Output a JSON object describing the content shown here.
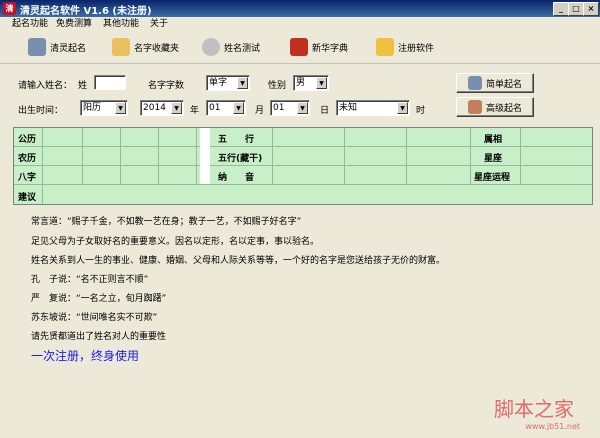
{
  "window": {
    "title": "清灵起名软件 V1.6 (未注册)",
    "app_icon": "清",
    "min": "_",
    "max": "□",
    "close": "×"
  },
  "menu": [
    "起名功能",
    "免费测算",
    "其他功能",
    "关于"
  ],
  "toolbar": [
    {
      "label": "清灵起名",
      "icon": "magnifier-icon",
      "color": "#7a8fb0"
    },
    {
      "label": "名字收藏夹",
      "icon": "folder-icon",
      "color": "#e8c060"
    },
    {
      "label": "姓名测试",
      "icon": "cd-icon",
      "color": "#c0c0c0"
    },
    {
      "label": "新华字典",
      "icon": "book-icon",
      "color": "#c03020"
    },
    {
      "label": "注册软件",
      "icon": "key-icon",
      "color": "#f0c040"
    }
  ],
  "form": {
    "surname_label": "请输入姓名：",
    "surname_prefix": "姓",
    "surname_value": "",
    "name_count_label": "名字字数",
    "name_count_value": "单字",
    "gender_label": "性别",
    "gender_value": "男",
    "birth_label": "出生时间：",
    "calendar_value": "阳历",
    "year_value": "2014",
    "year_label": "年",
    "month_value": "01",
    "month_label": "月",
    "day_value": "01",
    "day_label": "日",
    "hour_value": "未知",
    "hour_label": "时",
    "simple_button": "简单起名",
    "advanced_button": "高级起名"
  },
  "grid": {
    "left_labels": [
      "公历",
      "农历",
      "八字",
      "建议"
    ],
    "middle_labels": [
      "五　　行",
      "五行(藏干)",
      "纳　　音"
    ],
    "right_labels": [
      "属相",
      "星座",
      "星座运程"
    ]
  },
  "text": {
    "lines": [
      "常言道：“赐子千金，不如教一艺在身；教子一艺，不如赐子好名字”",
      "足见父母为子女取好名的重要意义。因名以定形，名以定事，事以验名。",
      "姓名关系到人一生的事业、健康、婚姻、父母和人际关系等等，一个好的名字是您送给孩子无价的财富。",
      "孔　子说：“名不正则言不顺”",
      "严　复说：“一名之立，旬月踟躇”",
      "苏东坡说：“世间唯名实不可欺”",
      "请先贤都道出了姓名对人的重要性"
    ],
    "highlight": "一次注册，终身使用",
    "highlight_color": "#1a1aee"
  },
  "watermark": {
    "text": "脚本之家",
    "sub": "www.jb51.net",
    "color": "#e06a6a"
  }
}
